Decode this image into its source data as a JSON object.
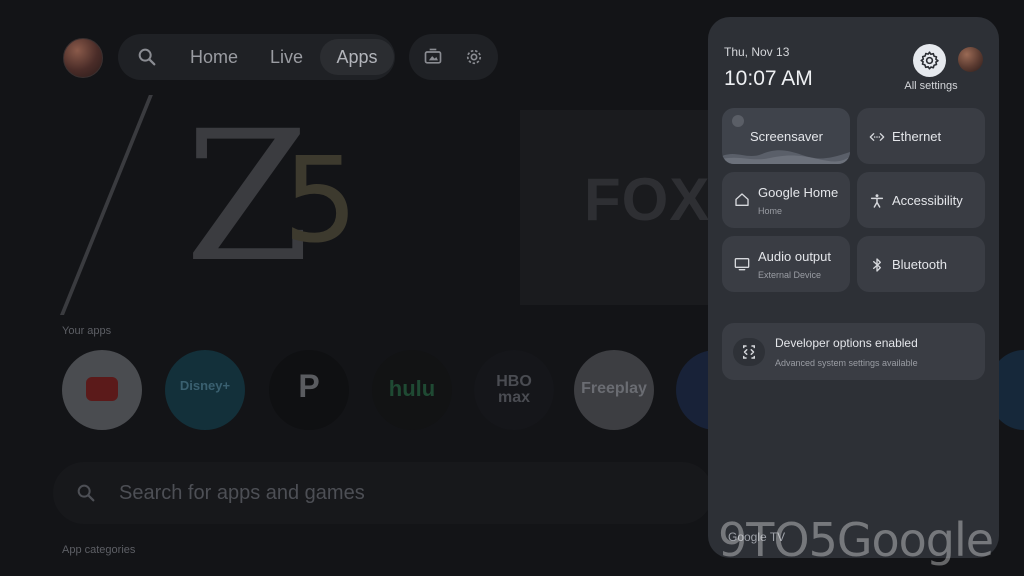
{
  "background": {
    "nav": {
      "home": "Home",
      "live": "Live",
      "apps": "Apps"
    },
    "hero": {
      "brand_letter": "Z",
      "brand_number": "5",
      "right_brand": "FOX"
    },
    "your_apps_label": "Your apps",
    "apps": [
      {
        "name": "YouTube",
        "label": ""
      },
      {
        "name": "Disney+",
        "label": "Disney+"
      },
      {
        "name": "Peacock",
        "label": "P"
      },
      {
        "name": "Hulu",
        "label": "hulu"
      },
      {
        "name": "HBO Max",
        "label": "HBO max"
      },
      {
        "name": "Freeplay",
        "label": "Freeplay"
      }
    ],
    "search_placeholder": "Search for apps and games",
    "app_categories_label": "App categories"
  },
  "panel": {
    "date": "Thu, Nov 13",
    "time": "10:07 AM",
    "all_settings": "All settings",
    "tiles": {
      "screensaver": {
        "title": "Screensaver"
      },
      "ethernet": {
        "title": "Ethernet"
      },
      "google_home": {
        "title": "Google Home",
        "sub": "Home"
      },
      "accessibility": {
        "title": "Accessibility"
      },
      "audio_output": {
        "title": "Audio output",
        "sub": "External Device"
      },
      "bluetooth": {
        "title": "Bluetooth"
      }
    },
    "developer": {
      "title": "Developer options enabled",
      "sub": "Advanced system settings available"
    },
    "brand": "Google TV"
  },
  "watermark": "9TO5Google",
  "colors": {
    "panel_bg": "#2d3036",
    "tile_bg": "#3a3d44",
    "gear_btn": "#e6e9ee"
  }
}
